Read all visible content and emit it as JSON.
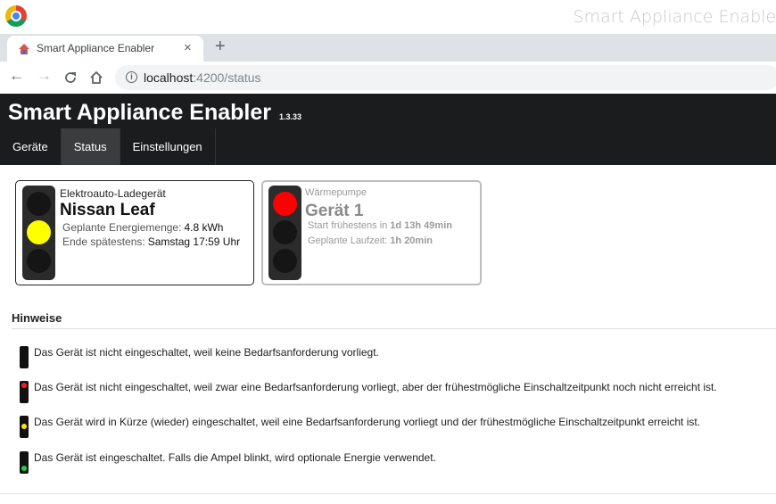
{
  "window": {
    "title": "Smart Appliance Enabler"
  },
  "tab": {
    "title": "Smart Appliance Enabler",
    "close": "×",
    "new": "+"
  },
  "toolbar": {
    "back": "←",
    "forward": "→",
    "reload": "C",
    "home": "⌂",
    "url_host": "localhost",
    "url_path": ":4200/status"
  },
  "app": {
    "brand": "Smart Appliance Enabler",
    "version": "1.3.33",
    "menu": [
      {
        "label": "Geräte"
      },
      {
        "label": "Status"
      },
      {
        "label": "Einstellungen"
      }
    ]
  },
  "cards": [
    {
      "type": "Elektroauto-Ladegerät",
      "name": "Nissan Leaf",
      "light": "yellow",
      "rows": [
        {
          "label": "Geplante Energiemenge:",
          "value": "4.8 kWh"
        },
        {
          "label": "Ende spätestens:",
          "value": "Samstag 17:59 Uhr"
        }
      ]
    },
    {
      "type": "Wärmepumpe",
      "name": "Gerät 1",
      "light": "red",
      "rows": [
        {
          "label": "Start frühestens in",
          "value": "1d 13h 49min"
        },
        {
          "label": "Geplante Laufzeit:",
          "value": "1h 20min"
        }
      ]
    }
  ],
  "hints": {
    "title": "Hinweise",
    "items": [
      {
        "light": "off",
        "text": "Das Gerät ist nicht eingeschaltet, weil keine Bedarfsanforderung vorliegt."
      },
      {
        "light": "red",
        "text": "Das Gerät ist nicht eingeschaltet, weil zwar eine Bedarfsanforderung vorliegt, aber der frühestmögliche Einschaltzeitpunkt noch nicht erreicht ist."
      },
      {
        "light": "yellow",
        "text": "Das Gerät wird in Kürze (wieder) eingeschaltet, weil eine Bedarfsanforderung vorliegt und der frühestmögliche Einschaltzeitpunkt erreicht ist."
      },
      {
        "light": "green",
        "text": "Das Gerät ist eingeschaltet. Falls die Ampel blinkt, wird optionale Energie verwendet."
      }
    ]
  },
  "colors": {
    "header_bg": "#1b1c1d",
    "active_menu": "#3b3c3d",
    "lamp_red": "#ff0000",
    "lamp_yellow": "#ffff00",
    "lamp_green": "#1fd14a"
  }
}
